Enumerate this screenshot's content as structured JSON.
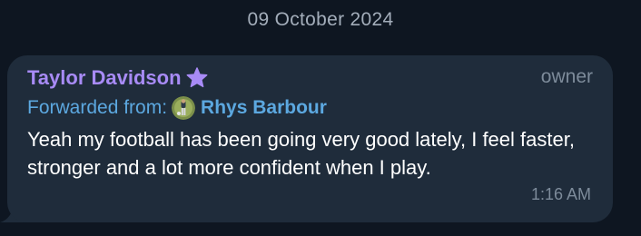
{
  "date_separator": "09 October 2024",
  "message": {
    "sender_name": "Taylor Davidson",
    "sender_badge_icon": "star-icon",
    "role": "owner",
    "forward_label": "Forwarded from:",
    "forward_avatar_icon": "avatar-photo",
    "forward_name": "Rhys Barbour",
    "text": "Yeah my football has been going very good lately, I feel faster, stronger and a lot more confident when I play.",
    "time": "1:16 AM"
  },
  "colors": {
    "background": "#0e1621",
    "bubble": "#1f2c3b",
    "sender_name": "#a88bf6",
    "forward_link": "#5ca8e0",
    "muted_text": "#7d8b9a",
    "message_text": "#ffffff"
  }
}
